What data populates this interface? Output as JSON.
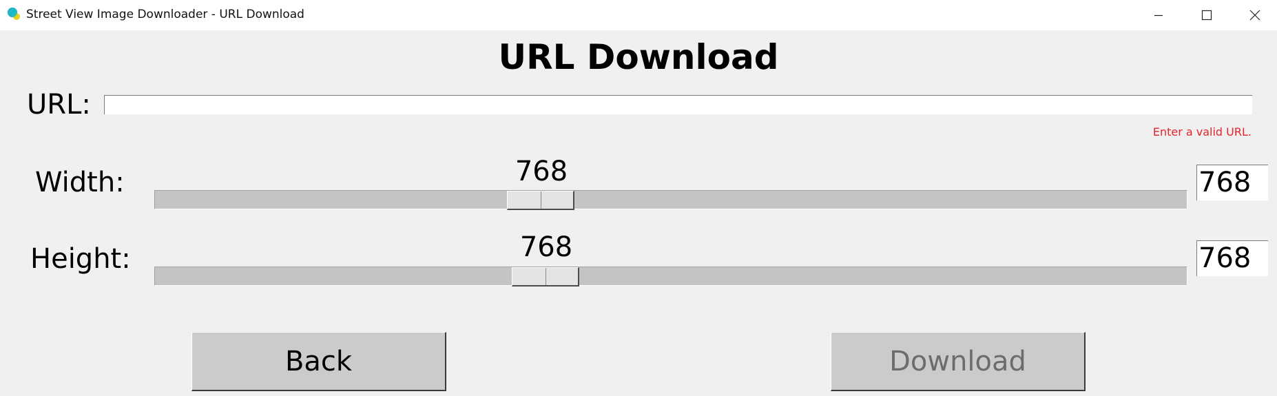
{
  "window": {
    "title": "Street View Image Downloader - URL Download",
    "icon": "app-logo-icon",
    "controls": [
      "minimize-icon",
      "maximize-icon",
      "close-icon"
    ]
  },
  "page": {
    "title": "URL Download"
  },
  "url": {
    "label": "URL:",
    "value": "",
    "error": "Enter a valid URL."
  },
  "width": {
    "label": "Width:",
    "slider_value": "768",
    "entry_value": "768"
  },
  "height": {
    "label": "Height:",
    "slider_value": "768",
    "entry_value": "768"
  },
  "buttons": {
    "back": "Back",
    "download": "Download"
  },
  "colors": {
    "error": "#e8222a",
    "disabled_text": "#6c6c6c",
    "background": "#f0f0f0"
  }
}
